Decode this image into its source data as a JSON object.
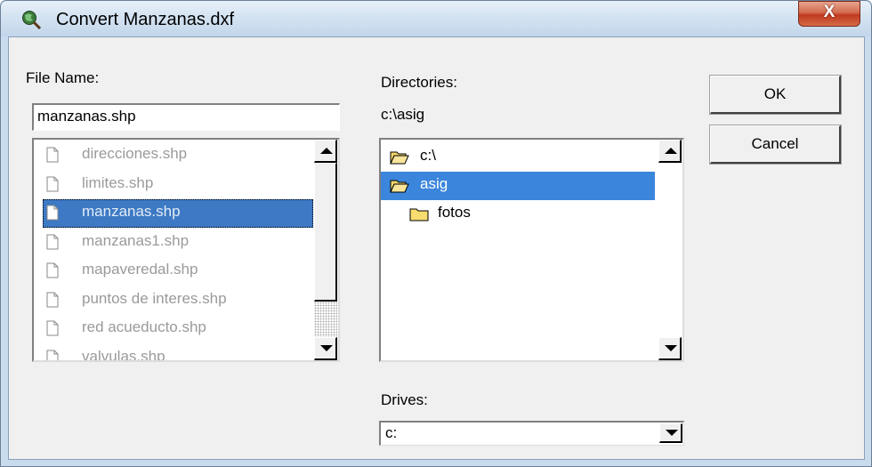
{
  "window": {
    "title": "Convert Manzanas.dxf",
    "close_glyph": "X"
  },
  "file_name": {
    "label": "File Name:",
    "value": "manzanas.shp",
    "files": [
      "direcciones.shp",
      "limites.shp",
      "manzanas.shp",
      "manzanas1.shp",
      "mapaveredal.shp",
      "puntos de interes.shp",
      "red acueducto.shp",
      "valvulas.shp"
    ],
    "selected_index": 2
  },
  "directories": {
    "label": "Directories:",
    "current_path": "c:\\asig",
    "items": [
      {
        "name": "c:\\",
        "icon": "open-folder-icon"
      },
      {
        "name": "asig",
        "icon": "open-folder-icon",
        "selected": true
      },
      {
        "name": "fotos",
        "icon": "folder-icon"
      }
    ]
  },
  "drives": {
    "label": "Drives:",
    "value": "c:"
  },
  "buttons": {
    "ok": "OK",
    "cancel": "Cancel"
  },
  "colors": {
    "selection": "#3b86dc",
    "close_button": "#c0391f",
    "dialog_bg": "#f0f0f0"
  }
}
